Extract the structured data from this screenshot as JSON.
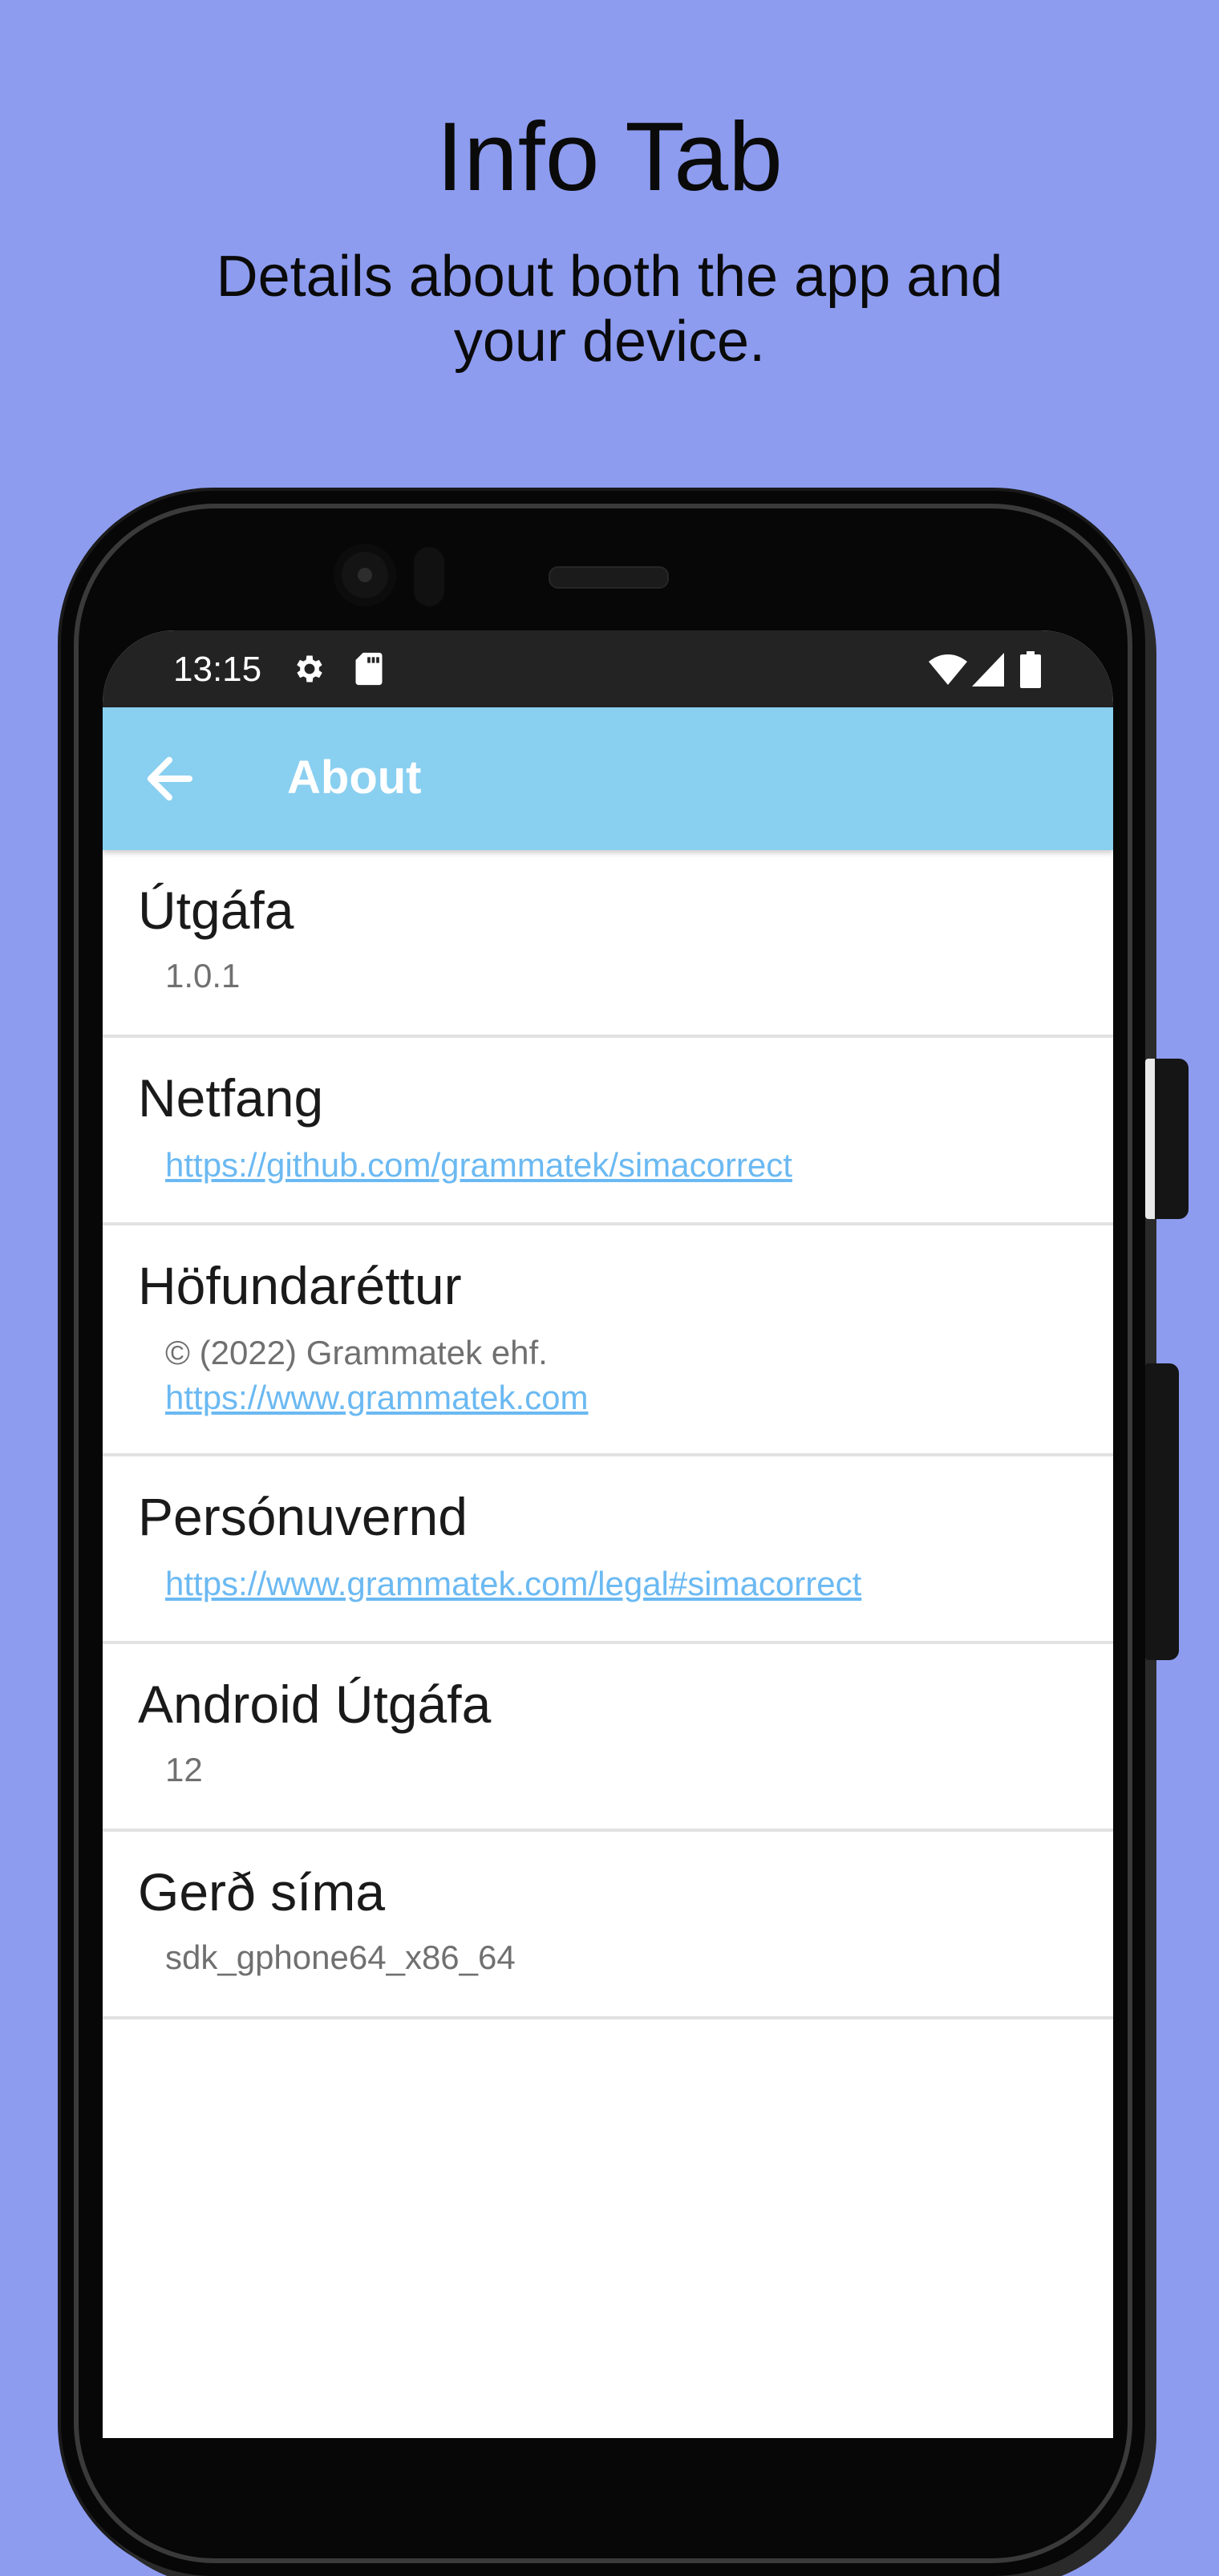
{
  "promo": {
    "title": "Info Tab",
    "subtitle": "Details about both the app and your device."
  },
  "status_bar": {
    "time": "13:15",
    "icons": [
      "gear-icon",
      "sd-card-icon",
      "wifi-icon",
      "cellular-signal-icon",
      "battery-icon"
    ]
  },
  "app_bar": {
    "back_icon": "arrow-left-icon",
    "title": "About",
    "background_color": "#89cff0"
  },
  "items": [
    {
      "title": "Útgáfa",
      "value": "1.0.1"
    },
    {
      "title": "Netfang",
      "link": "https://github.com/grammatek/simacorrect"
    },
    {
      "title": "Höfundaréttur",
      "value": "© (2022) Grammatek ehf.",
      "link": "https://www.grammatek.com"
    },
    {
      "title": "Persónuvernd",
      "link": "https://www.grammatek.com/legal#simacorrect"
    },
    {
      "title": "Android Útgáfa",
      "value": "12"
    },
    {
      "title": "Gerð síma",
      "value": "sdk_gphone64_x86_64"
    }
  ],
  "colors": {
    "page_background": "#8d9cef",
    "link": "#6bb9f2",
    "status_bar": "#232323"
  }
}
